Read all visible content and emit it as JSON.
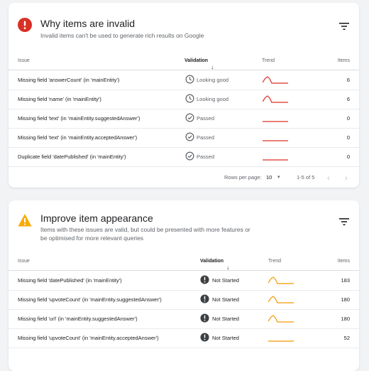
{
  "invalid_card": {
    "title": "Why items are invalid",
    "description": "Invalid items can't be used to generate rich results on Google",
    "columns": {
      "issue": "Issue",
      "validation": "Validation",
      "trend": "Trend",
      "items": "Items"
    },
    "rows": [
      {
        "issue": "Missing field 'answerCount' (in 'mainEntity')",
        "validation": "Looking good",
        "status": "looking-good",
        "trend": "bump",
        "items": "6"
      },
      {
        "issue": "Missing field 'name' (in 'mainEntity')",
        "validation": "Looking good",
        "status": "looking-good",
        "trend": "bump",
        "items": "6"
      },
      {
        "issue": "Missing field 'text' (in 'mainEntity.suggestedAnswer')",
        "validation": "Passed",
        "status": "passed",
        "trend": "flat",
        "items": "0"
      },
      {
        "issue": "Missing field 'text' (in 'mainEntity.acceptedAnswer')",
        "validation": "Passed",
        "status": "passed",
        "trend": "flat",
        "items": "0"
      },
      {
        "issue": "Duplicate field 'datePublished' (in 'mainEntity')",
        "validation": "Passed",
        "status": "passed",
        "trend": "flat",
        "items": "0"
      }
    ],
    "pagination": {
      "rows_per_page_label": "Rows per page:",
      "rows_per_page": "10",
      "range": "1-5 of 5"
    }
  },
  "improve_card": {
    "title": "Improve item appearance",
    "description": "Items with these issues are valid, but could be presented with more features or be optimised for more relevant queries",
    "columns": {
      "issue": "Issue",
      "validation": "Validation",
      "trend": "Trend",
      "items": "Items"
    },
    "rows": [
      {
        "issue": "Missing field 'datePublished' (in 'mainEntity')",
        "validation": "Not Started",
        "status": "not-started",
        "trend": "bump",
        "items": "183"
      },
      {
        "issue": "Missing field 'upvoteCount' (in 'mainEntity.suggestedAnswer')",
        "validation": "Not Started",
        "status": "not-started",
        "trend": "bump",
        "items": "180"
      },
      {
        "issue": "Missing field 'url' (in 'mainEntity.suggestedAnswer')",
        "validation": "Not Started",
        "status": "not-started",
        "trend": "bump",
        "items": "180"
      },
      {
        "issue": "Missing field 'upvoteCount' (in 'mainEntity.acceptedAnswer')",
        "validation": "Not Started",
        "status": "not-started",
        "trend": "flat",
        "items": "52"
      }
    ]
  },
  "colors": {
    "error": "#d93025",
    "warning": "#f9ab00",
    "trend_error": "#d93025",
    "trend_warning": "#f29900"
  },
  "icons": {
    "invalid_status": "error-icon",
    "improve_status": "warning-icon",
    "filter": "filter-icon"
  }
}
